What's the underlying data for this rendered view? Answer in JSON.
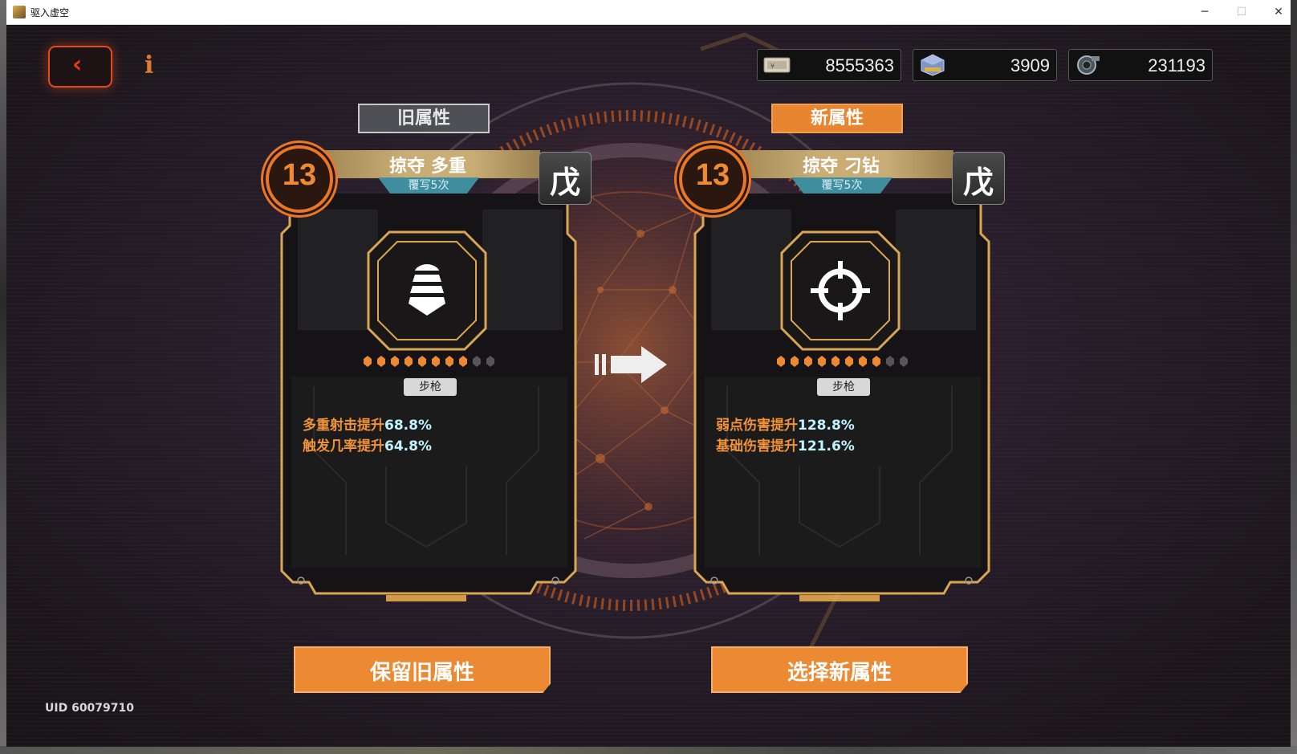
{
  "window": {
    "title": "驱入虚空",
    "minimize_glyph": "─",
    "maximize_glyph": "☐",
    "close_glyph": "✕"
  },
  "header": {
    "back_glyph": "‹",
    "info_glyph": "i",
    "currencies": [
      {
        "icon": "ticket-icon",
        "value": "8555363"
      },
      {
        "icon": "cube-crystal-icon",
        "value": "3909"
      },
      {
        "icon": "gear-part-icon",
        "value": "231193"
      }
    ]
  },
  "old_attr": {
    "label": "旧属性",
    "level": "13",
    "name": "掠夺 多重",
    "rewrite": "覆写5次",
    "grade": "戊",
    "icon": "stacked-bullets-icon",
    "pips_filled": 8,
    "pips_total": 10,
    "weapon_type": "步枪",
    "stats": [
      {
        "label": "多重射击提升",
        "value": "68.8%"
      },
      {
        "label": "触发几率提升",
        "value": "64.8%"
      }
    ]
  },
  "new_attr": {
    "label": "新属性",
    "level": "13",
    "name": "掠夺 刁钻",
    "rewrite": "覆写5次",
    "grade": "戊",
    "icon": "crosshair-icon",
    "pips_filled": 8,
    "pips_total": 10,
    "weapon_type": "步枪",
    "stats": [
      {
        "label": "弱点伤害提升",
        "value": "128.8%"
      },
      {
        "label": "基础伤害提升",
        "value": "121.6%"
      }
    ]
  },
  "actions": {
    "keep_old": "保留旧属性",
    "choose_new": "选择新属性"
  },
  "footer": {
    "uid": "UID 60079710"
  },
  "colors": {
    "accent_orange": "#ec8a33",
    "stat_value": "#bff3ff",
    "back_red": "#e53a16"
  }
}
